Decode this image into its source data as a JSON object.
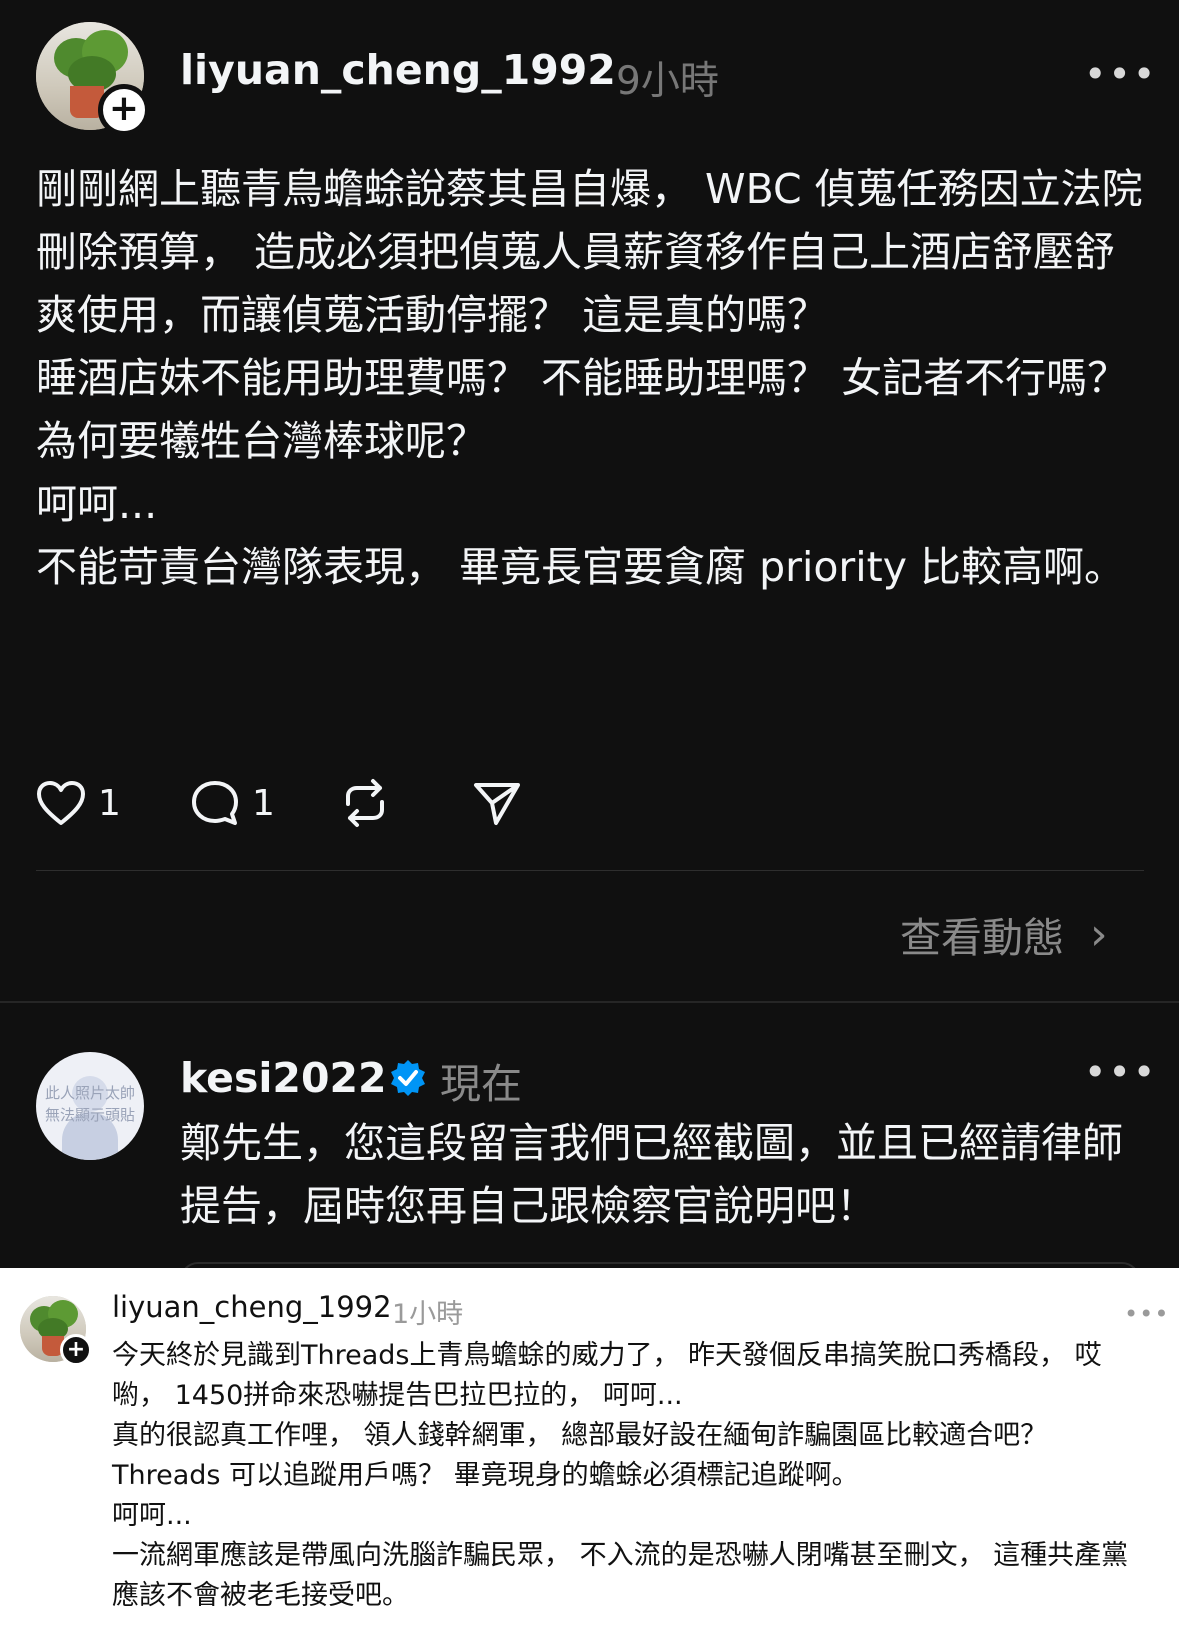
{
  "post": {
    "username": "liyuan_cheng_1992",
    "time": "9小時",
    "more": "•••",
    "paragraphs": [
      "剛剛網上聽青鳥蟾蜍說蔡其昌自爆， WBC 偵蒐任務因立法院刪除預算， 造成必須把偵蒐人員薪資移作自己上酒店舒壓舒爽使用，而讓偵蒐活動停擺？ 這是真的嗎？",
      "睡酒店妹不能用助理費嗎？ 不能睡助理嗎？ 女記者不行嗎？為何要犧牲台灣棒球呢？",
      "呵呵...",
      "不能苛責台灣隊表現， 畢竟長官要貪腐 priority 比較高啊。"
    ],
    "likes": "1",
    "comments": "1",
    "view_activity": "查看動態",
    "view_activity_chevron": "›"
  },
  "reply": {
    "username": "kesi2022",
    "time": "現在",
    "more": "•••",
    "avatar_text": "此人照片太帥\n無法顯示頭貼",
    "text": "鄭先生，您這段留言我們已經截圖，並且已經請律師提告，屆時您再自己跟檢察官說明吧！"
  },
  "screenshot_post": {
    "username": "liyuan_cheng_1992",
    "time": "1小時",
    "more": "•••",
    "paragraphs": [
      "今天終於見識到Threads上青鳥蟾蜍的威力了， 昨天發個反串搞笑脫口秀橋段， 哎喲， 1450拼命來恐嚇提告巴拉巴拉的， 呵呵...",
      "真的很認真工作哩， 領人錢幹網軍， 總部最好設在緬甸詐騙園區比較適合吧？ Threads 可以追蹤用戶嗎？ 畢竟現身的蟾蜍必須標記追蹤啊。",
      "呵呵...",
      "一流網軍應該是帶風向洗腦詐騙民眾， 不入流的是恐嚇人閉嘴甚至刪文， 這種共產黨應該不會被老毛接受吧。"
    ]
  },
  "colors": {
    "dark_bg": "#101010",
    "text_primary": "#f3f5f7",
    "text_muted": "#777777",
    "verified_blue": "#0095f6",
    "light_bg": "#ffffff"
  },
  "icons": [
    "plus-icon",
    "more-icon",
    "heart-icon",
    "comment-icon",
    "repost-icon",
    "share-icon",
    "chevron-right-icon",
    "verified-badge-icon"
  ]
}
